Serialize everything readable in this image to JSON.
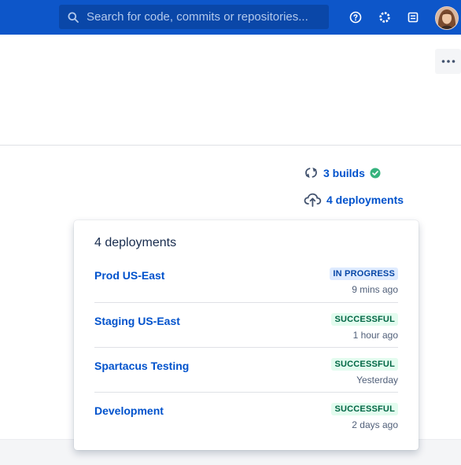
{
  "header": {
    "search_placeholder": "Search for code, commits or repositories...",
    "icons": [
      "search-icon",
      "help-icon",
      "settings-icon",
      "notes-icon",
      "avatar"
    ],
    "background": "#0d56c9"
  },
  "summary": {
    "builds_label": "3 builds",
    "deployments_label": "4 deployments"
  },
  "popup": {
    "title": "4 deployments",
    "deployments": [
      {
        "name": "Prod US-East",
        "status": "IN PROGRESS",
        "time": "9 mins ago"
      },
      {
        "name": "Staging US-East",
        "status": "SUCCESSFUL",
        "time": "1 hour ago"
      },
      {
        "name": "Spartacus Testing",
        "status": "SUCCESSFUL",
        "time": "Yesterday"
      },
      {
        "name": "Development",
        "status": "SUCCESSFUL",
        "time": "2 days ago"
      }
    ]
  },
  "colors": {
    "link": "#0052cc",
    "success": "#36b37e",
    "in_progress_bg": "#deebff",
    "successful_bg": "#e3fcef"
  }
}
